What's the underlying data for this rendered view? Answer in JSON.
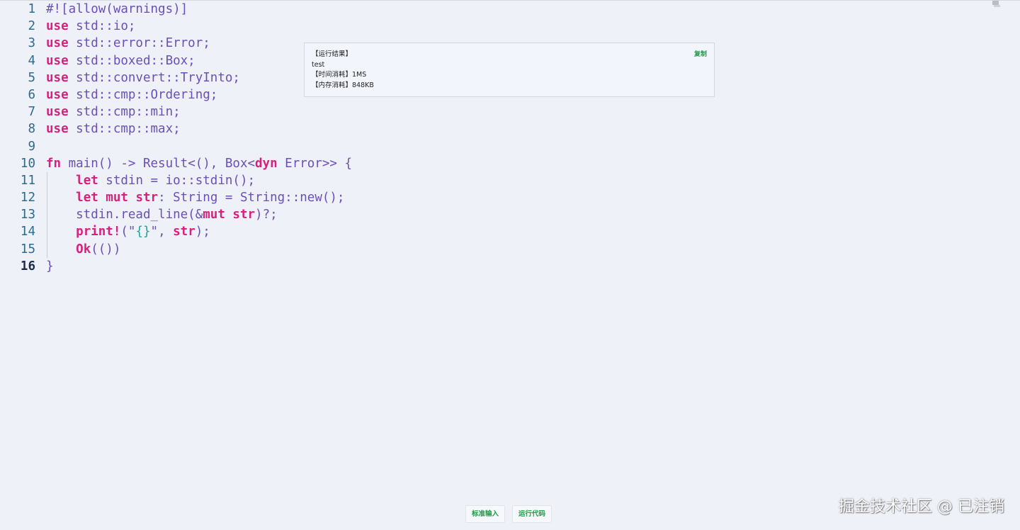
{
  "editor": {
    "lines": [
      {
        "n": "1",
        "tokens": [
          {
            "t": "#![allow(warnings)]",
            "c": "plain"
          }
        ]
      },
      {
        "n": "2",
        "tokens": [
          {
            "t": "use",
            "c": "kw"
          },
          {
            "t": " std::io;",
            "c": "plain"
          }
        ]
      },
      {
        "n": "3",
        "tokens": [
          {
            "t": "use",
            "c": "kw"
          },
          {
            "t": " std::error::Error;",
            "c": "plain"
          }
        ]
      },
      {
        "n": "4",
        "tokens": [
          {
            "t": "use",
            "c": "kw"
          },
          {
            "t": " std::boxed::Box;",
            "c": "plain"
          }
        ]
      },
      {
        "n": "5",
        "tokens": [
          {
            "t": "use",
            "c": "kw"
          },
          {
            "t": " std::convert::TryInto;",
            "c": "plain"
          }
        ]
      },
      {
        "n": "6",
        "tokens": [
          {
            "t": "use",
            "c": "kw"
          },
          {
            "t": " std::cmp::Ordering;",
            "c": "plain"
          }
        ]
      },
      {
        "n": "7",
        "tokens": [
          {
            "t": "use",
            "c": "kw"
          },
          {
            "t": " std::cmp::min;",
            "c": "plain"
          }
        ]
      },
      {
        "n": "8",
        "tokens": [
          {
            "t": "use",
            "c": "kw"
          },
          {
            "t": " std::cmp::max;",
            "c": "plain"
          }
        ]
      },
      {
        "n": "9",
        "tokens": []
      },
      {
        "n": "10",
        "tokens": [
          {
            "t": "fn",
            "c": "kw"
          },
          {
            "t": " main() -> Result<(), Box<",
            "c": "plain"
          },
          {
            "t": "dyn",
            "c": "kw"
          },
          {
            "t": " Error>> {",
            "c": "plain"
          }
        ]
      },
      {
        "n": "11",
        "tokens": [
          {
            "t": "    ",
            "c": "plain"
          },
          {
            "t": "let",
            "c": "kw"
          },
          {
            "t": " stdin = io::stdin();",
            "c": "plain"
          }
        ]
      },
      {
        "n": "12",
        "tokens": [
          {
            "t": "    ",
            "c": "plain"
          },
          {
            "t": "let mut str",
            "c": "kw"
          },
          {
            "t": ": String = String::new();",
            "c": "plain"
          }
        ]
      },
      {
        "n": "13",
        "tokens": [
          {
            "t": "    stdin.read_line(&",
            "c": "plain"
          },
          {
            "t": "mut str",
            "c": "kw"
          },
          {
            "t": ")?;",
            "c": "plain"
          }
        ]
      },
      {
        "n": "14",
        "tokens": [
          {
            "t": "    ",
            "c": "plain"
          },
          {
            "t": "print!",
            "c": "kw"
          },
          {
            "t": "(\"",
            "c": "plain"
          },
          {
            "t": "{}",
            "c": "str"
          },
          {
            "t": "\", ",
            "c": "plain"
          },
          {
            "t": "str",
            "c": "kw"
          },
          {
            "t": ");",
            "c": "plain"
          }
        ]
      },
      {
        "n": "15",
        "tokens": [
          {
            "t": "    ",
            "c": "plain"
          },
          {
            "t": "Ok",
            "c": "kw"
          },
          {
            "t": "(())",
            "c": "plain"
          }
        ]
      },
      {
        "n": "16",
        "tokens": [
          {
            "t": "}",
            "c": "plain"
          }
        ],
        "active": true
      }
    ]
  },
  "result": {
    "header": "【运行结果】",
    "output": "test",
    "time_label": "【时间消耗】",
    "time_value": "1MS",
    "memory_label": "【内存消耗】",
    "memory_value": "848KB",
    "copy_label": "复制"
  },
  "bottom_bar": {
    "stdin_label": "标准输入",
    "run_label": "运行代码"
  },
  "watermark": "掘金技术社区 @ 已注销",
  "colors": {
    "keyword": "#d6217f",
    "identifier": "#6a4fb8",
    "string": "#1aa58f",
    "line_number": "#2c6a8e",
    "accent_green": "#1f9a45",
    "background": "#eff1f8"
  },
  "icons": {
    "corner": "pin-icon"
  }
}
